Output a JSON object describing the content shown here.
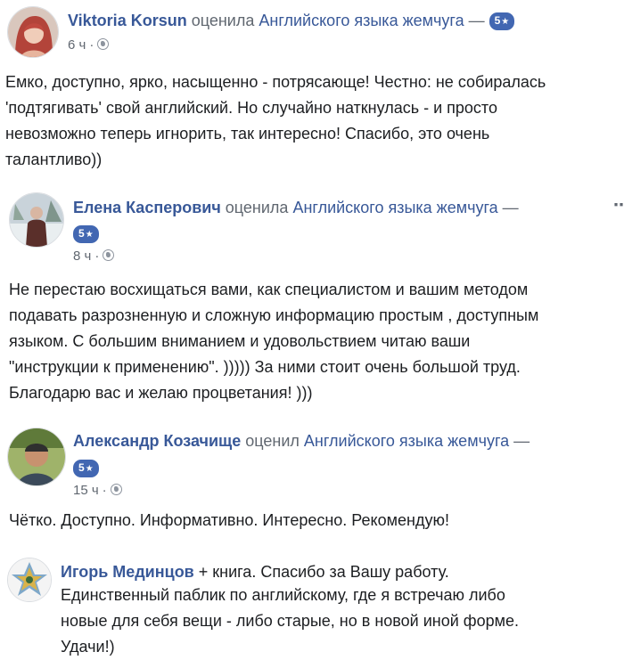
{
  "reviews": [
    {
      "name": "Viktoria Korsun",
      "verb": "оценила",
      "page": "Английского языка жемчуга",
      "dash": "—",
      "rating": "5",
      "time": "6 ч",
      "separator": "·",
      "text": "Емко, доступно, ярко, насыщенно - потрясающе! Честно: не собиралась\n'подтягивать' свой английский. Но случайно наткнулась - и просто\nневозможно теперь игнорить, так интересно! Спасибо, это очень\nталантливо))"
    },
    {
      "name": "Елена Касперович",
      "verb": "оценила",
      "page": "Английского языка жемчуга",
      "dash": "—",
      "rating": "5",
      "time": "8 ч",
      "separator": "·",
      "text": "Не перестаю восхищаться вами, как специалистом и вашим методом\nподавать разрозненную и сложную информацию простым , доступным\nязыком. С большим вниманием и удовольствием читаю ваши\n\"инструкции к применению\". ))))) За ними стоит очень большой труд.\nБлагодарю вас и желаю процветания! )))"
    },
    {
      "name": "Александр Козачище",
      "verb": "оценил",
      "page": "Английского языка жемчуга",
      "dash": "—",
      "rating": "5",
      "time": "15 ч",
      "separator": "·",
      "text": "Чётко. Доступно. Информативно. Интересно. Рекомендую!"
    },
    {
      "name": "Игорь Мединцов",
      "first_line_rest": " + книга. Спасибо за Вашу работу.",
      "text": "Единственный паблик по английскому, где я встречаю либо\nновые для себя вещи - либо старые, но в новой иной форме.\nУдачи!)"
    }
  ],
  "icons": {
    "rating_star": "star-icon",
    "privacy": "globe-icon",
    "more": "more-icon"
  },
  "colors": {
    "link": "#385898",
    "badge": "#4267b2",
    "meta": "#606770",
    "text": "#1c1e21"
  }
}
